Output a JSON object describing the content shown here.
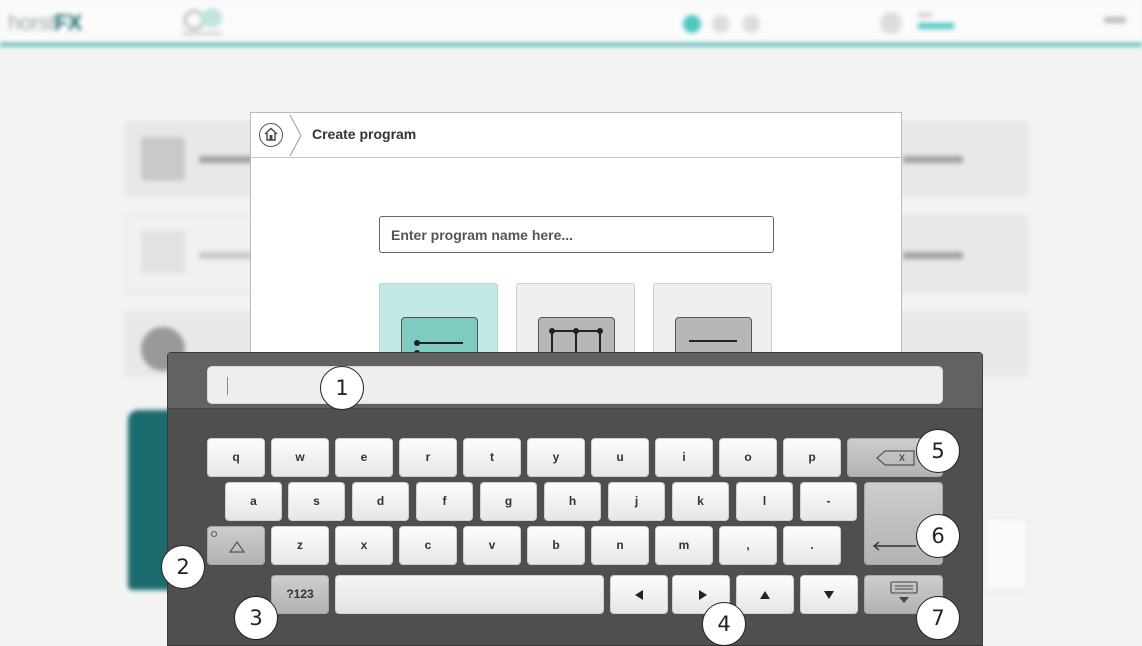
{
  "background": {
    "logo_light": "horst",
    "logo_bold": "FX",
    "accent_color": "#2aa79e",
    "robot_color": "#1b6b6f"
  },
  "dialog": {
    "title": "Create program",
    "home_icon": "home-icon",
    "name_input": {
      "placeholder": "Enter program name here...",
      "value": ""
    },
    "program_types": [
      {
        "icon": "textual-program-icon",
        "selected": true
      },
      {
        "icon": "graphical-program-icon",
        "selected": false
      },
      {
        "icon": "empty-program-icon",
        "selected": false
      }
    ]
  },
  "keyboard": {
    "input_value": "",
    "row1": [
      "q",
      "w",
      "e",
      "r",
      "t",
      "y",
      "u",
      "i",
      "o",
      "p"
    ],
    "row2": [
      "a",
      "s",
      "d",
      "f",
      "g",
      "h",
      "j",
      "k",
      "l",
      "-"
    ],
    "row3": [
      "z",
      "x",
      "c",
      "v",
      "b",
      "n",
      "m",
      ",",
      "."
    ],
    "backspace_glyph": "x",
    "symbols_label": "?123",
    "icons": {
      "backspace": "backspace-icon",
      "enter": "enter-icon",
      "shift": "shift-icon",
      "hide": "hide-keyboard-icon",
      "arrows": [
        "arrow-left-icon",
        "arrow-right-icon",
        "arrow-up-icon",
        "arrow-down-icon"
      ]
    }
  },
  "callouts": [
    "1",
    "2",
    "3",
    "4",
    "5",
    "6",
    "7"
  ]
}
